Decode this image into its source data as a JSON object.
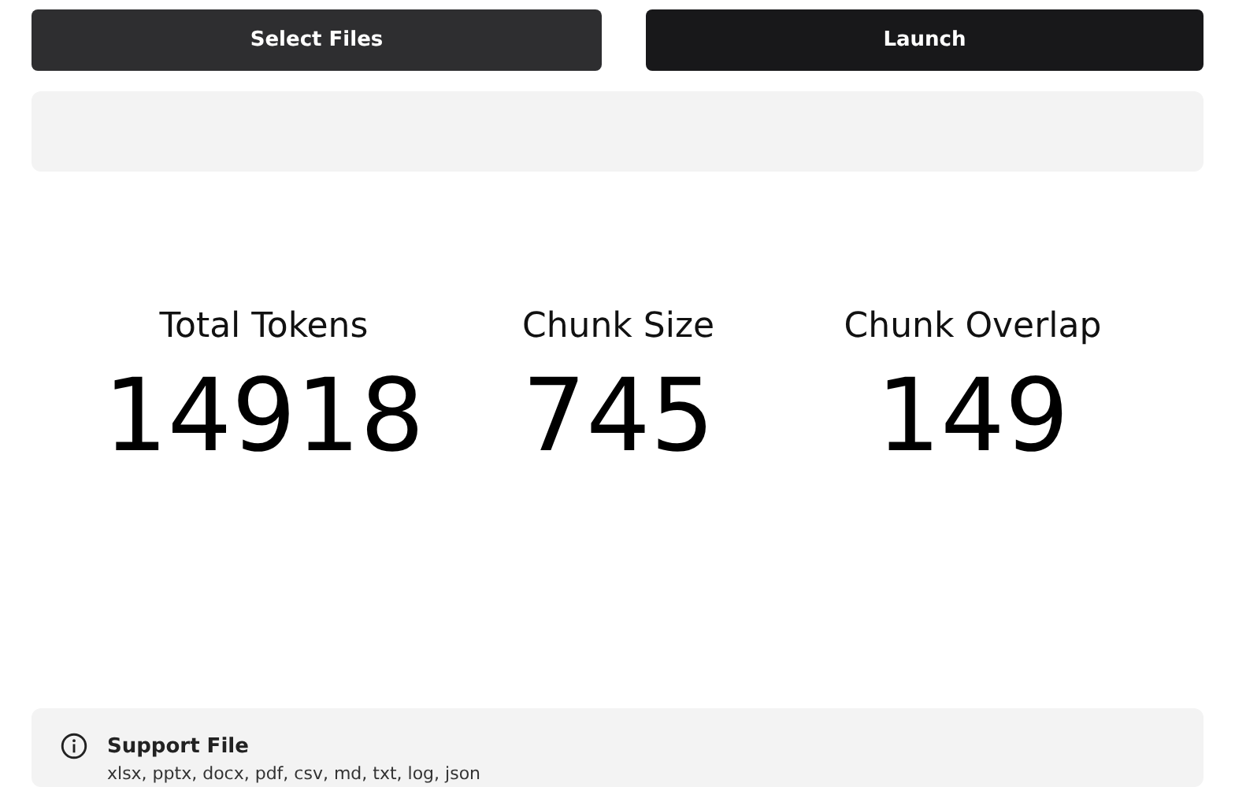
{
  "buttons": [
    {
      "label": "Select Files",
      "kind": "secondary"
    },
    {
      "label": "Launch",
      "kind": "primary"
    }
  ],
  "stats": [
    {
      "label": "Total Tokens",
      "value": "14918"
    },
    {
      "label": "Chunk Size",
      "value": "745"
    },
    {
      "label": "Chunk Overlap",
      "value": "149"
    }
  ],
  "info": {
    "title": "Support File",
    "text": "xlsx, pptx, docx, pdf, csv, md, txt, log, json"
  }
}
